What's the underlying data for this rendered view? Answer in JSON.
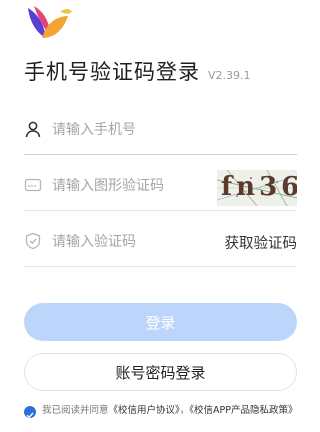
{
  "header": {
    "title": "手机号验证码登录",
    "version": "V2.39.1"
  },
  "fields": {
    "phone": {
      "placeholder": "请输入手机号",
      "value": ""
    },
    "captcha": {
      "placeholder": "请输入图形验证码",
      "value": "",
      "image_text": "fn36"
    },
    "sms": {
      "placeholder": "请输入验证码",
      "value": "",
      "get_code_label": "获取验证码"
    }
  },
  "buttons": {
    "login_label": "登录",
    "password_login_label": "账号密码登录"
  },
  "agreement": {
    "prefix": "我已阅读并同意",
    "link1": "《校信用户协议》",
    "sep": "，",
    "link2": "《校信APP产品隐私政策》",
    "checked": true
  },
  "colors": {
    "primary_disabled": "#bcd6fb",
    "check": "#2f6fd8"
  }
}
